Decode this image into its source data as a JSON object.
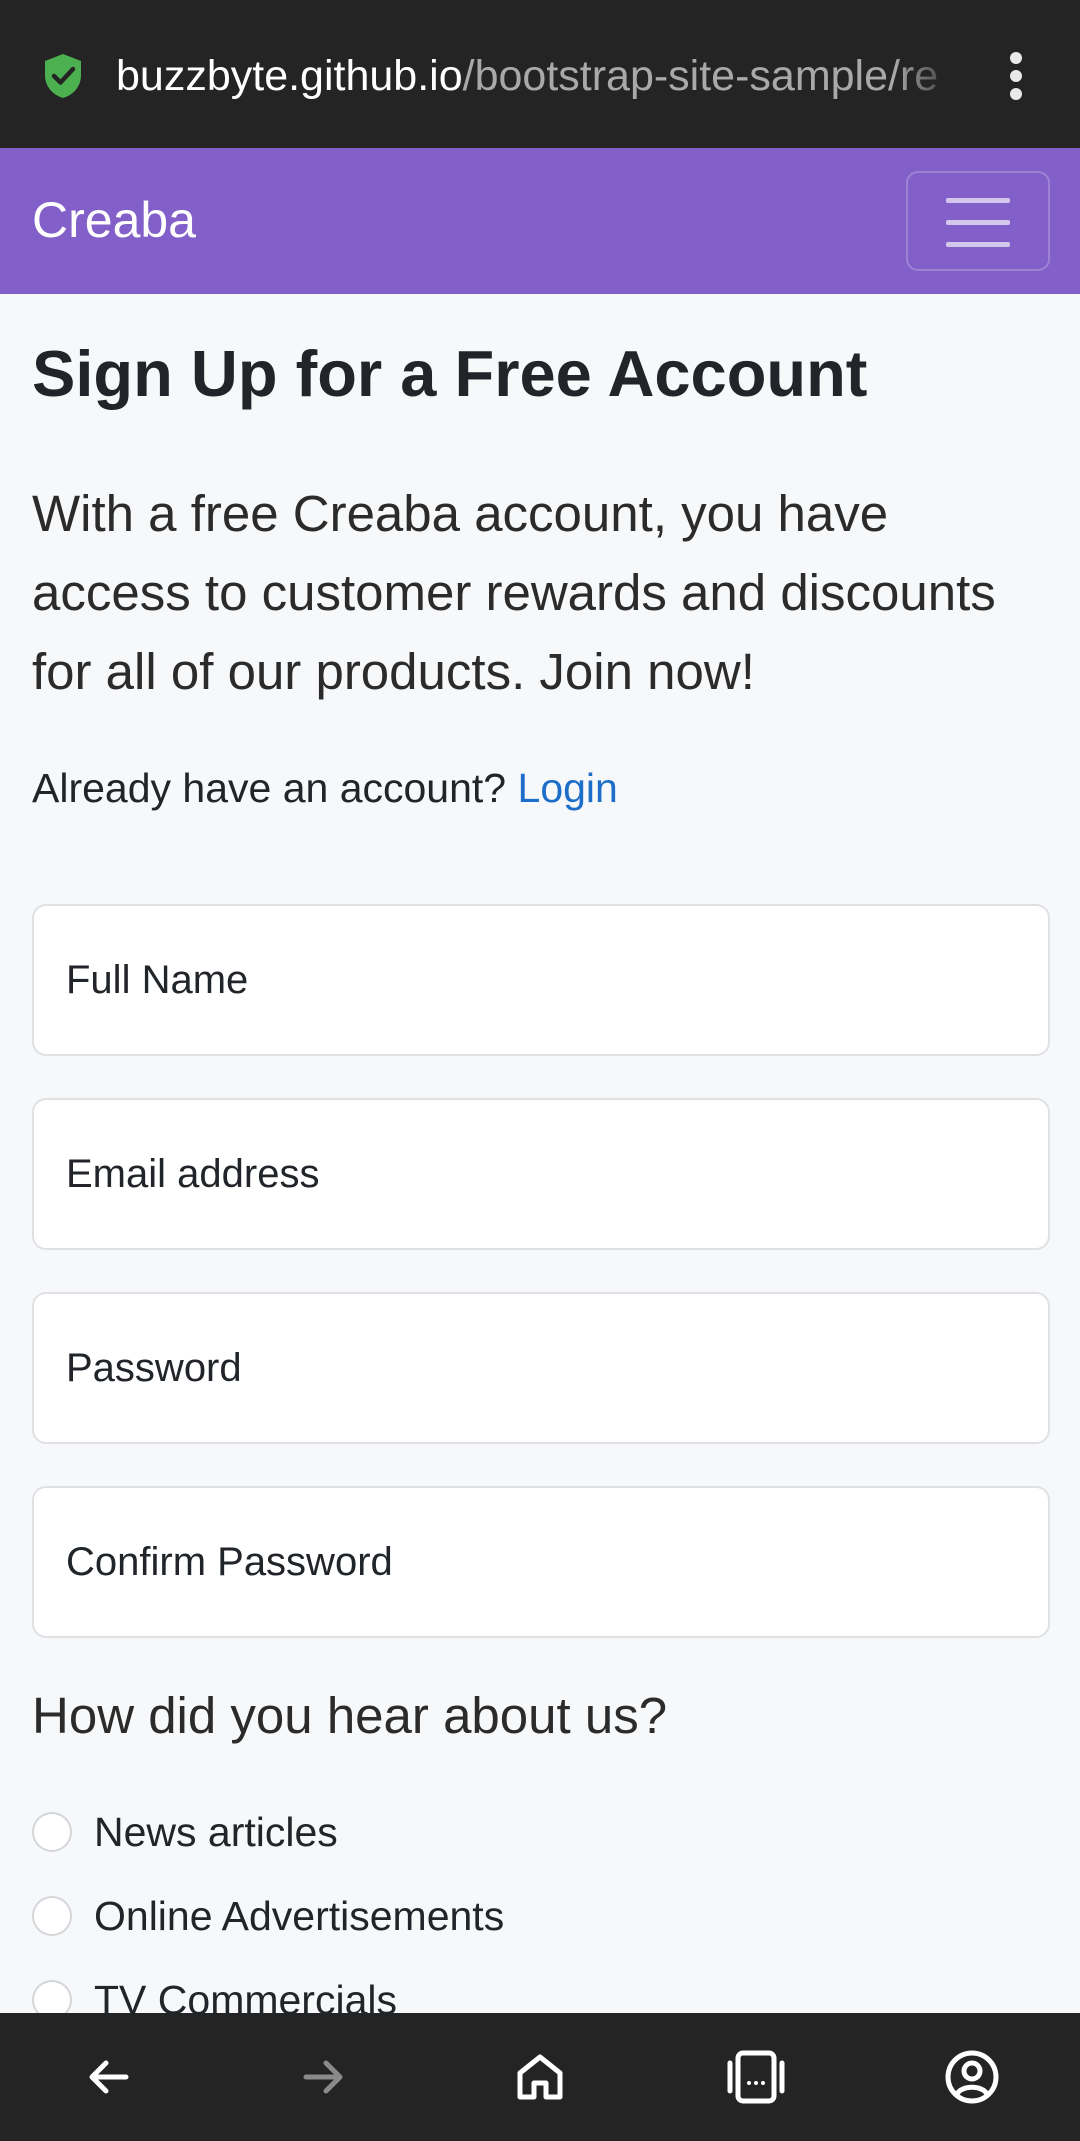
{
  "browser": {
    "url_host": "buzzbyte.github.io",
    "url_path": "/bootstrap-site-sample/re",
    "icons": [
      "shield-check-icon",
      "more-vert-icon"
    ]
  },
  "navbar": {
    "brand": "Creaba",
    "toggler_icon": "hamburger-icon",
    "color": "#8360c9"
  },
  "page": {
    "title": "Sign Up for a Free Account",
    "lead": "With a free Creaba account, you have access to customer rewards and discounts for all of our products. Join now!",
    "login_prompt": "Already have an account?",
    "login_link": "Login",
    "link_color": "#1c6ec9"
  },
  "form": {
    "full_name_placeholder": "Full Name",
    "email_placeholder": "Email address",
    "password_placeholder": "Password",
    "confirm_password_placeholder": "Confirm Password"
  },
  "survey": {
    "question": "How did you hear about us?",
    "options": [
      "News articles",
      "Online Advertisements",
      "TV Commercials"
    ]
  },
  "bottom_nav": {
    "icons": [
      "back-arrow-icon",
      "forward-arrow-icon",
      "home-icon",
      "tabs-icon",
      "account-icon"
    ]
  }
}
